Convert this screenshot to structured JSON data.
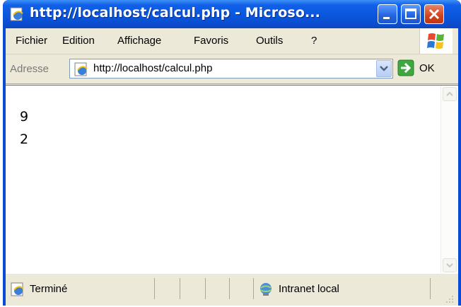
{
  "window": {
    "title": "http://localhost/calcul.php - Microso..."
  },
  "menu": {
    "items": [
      "Fichier",
      "Edition",
      "Affichage",
      "Favoris",
      "Outils",
      "?"
    ]
  },
  "address": {
    "label": "Adresse",
    "url": "http://localhost/calcul.php",
    "go_label": "OK"
  },
  "page": {
    "lines": [
      "9",
      "2"
    ]
  },
  "status": {
    "text": "Terminé",
    "zone": "Intranet local"
  },
  "icons": {
    "title": "ie-page-icon",
    "logo": "windows-flag-logo",
    "address": "ie-page-icon",
    "go": "green-arrow-icon",
    "status": "ie-page-icon",
    "zone": "intranet-globe-icon"
  },
  "colors": {
    "titlebar": "#0a56dc",
    "close_button": "#d1421d",
    "chrome": "#ece9d8",
    "go_arrow": "#3fa73f"
  }
}
